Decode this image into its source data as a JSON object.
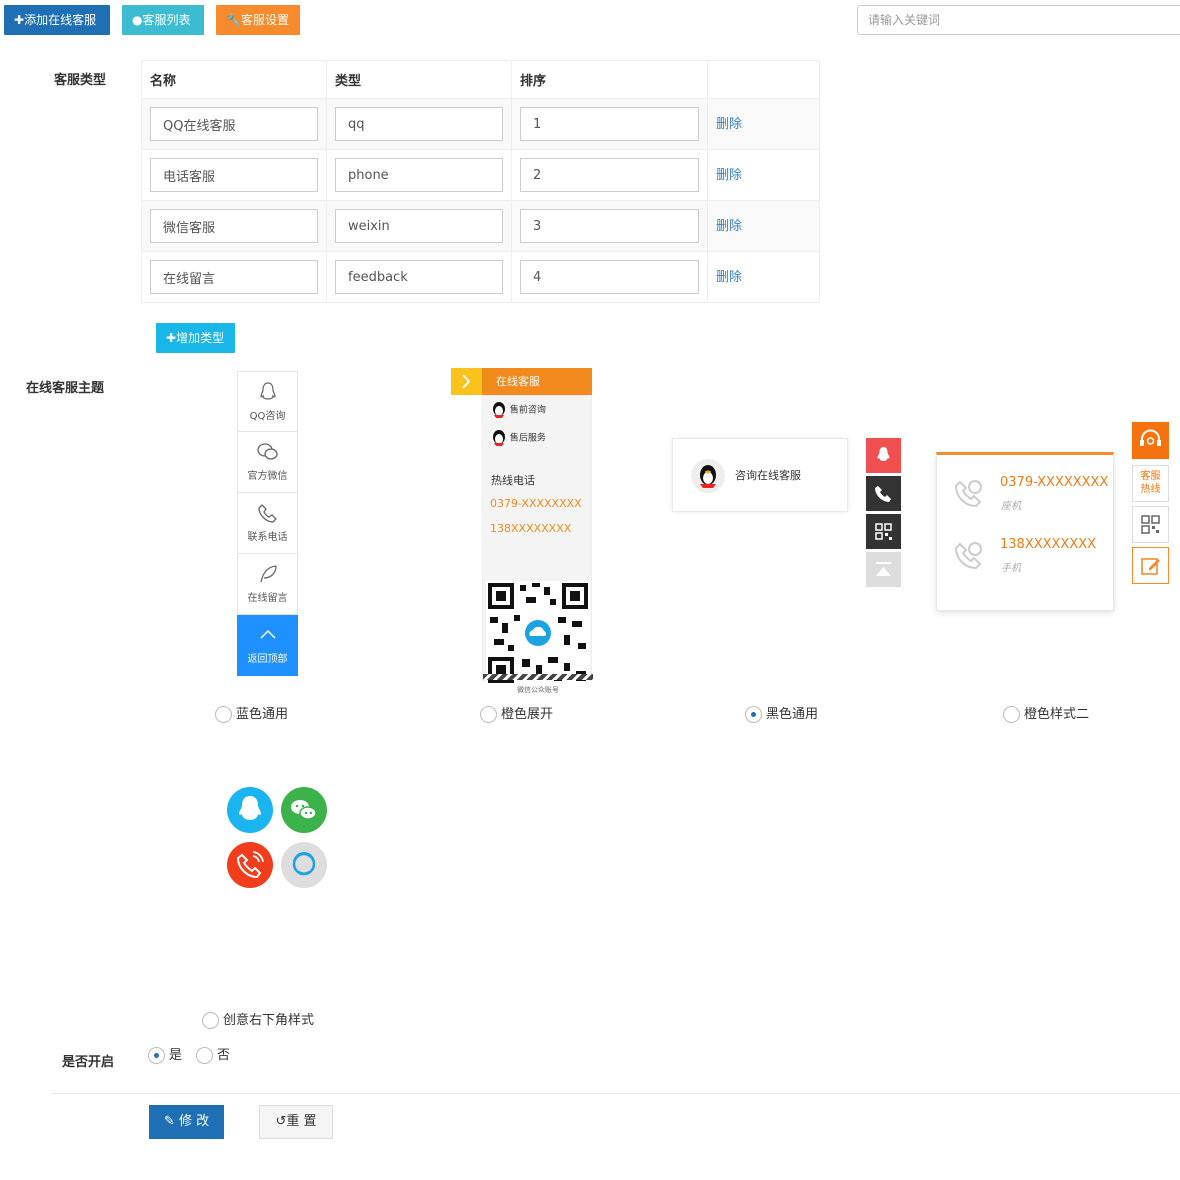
{
  "toolbar": {
    "add_label": "添加在线客服",
    "list_label": "客服列表",
    "settings_label": "客服设置",
    "search_placeholder": "请输入关键词"
  },
  "form": {
    "types_label": "客服类型",
    "theme_label": "在线客服主题",
    "enable_label": "是否开启"
  },
  "table": {
    "headers": [
      "名称",
      "类型",
      "排序",
      ""
    ],
    "rows": [
      {
        "name": "QQ在线客服",
        "type": "qq",
        "order": "1",
        "action": "删除"
      },
      {
        "name": "电话客服",
        "type": "phone",
        "order": "2",
        "action": "删除"
      },
      {
        "name": "微信客服",
        "type": "weixin",
        "order": "3",
        "action": "删除"
      },
      {
        "name": "在线留言",
        "type": "feedback",
        "order": "4",
        "action": "删除"
      }
    ],
    "add_type_label": "增加类型"
  },
  "themes": {
    "blue": {
      "items": [
        "QQ咨询",
        "官方微信",
        "联系电话",
        "在线留言",
        "返回顶部"
      ],
      "icons": [
        "qq-icon",
        "wechat-icon",
        "phone-icon",
        "feather-icon",
        "chevron-up-icon"
      ],
      "active_color": "#1e90ff"
    },
    "orange": {
      "header": "在线客服",
      "items": [
        "售前咨询",
        "售后服务"
      ],
      "hotline_title": "热线电话",
      "phone1": "0379-XXXXXXXX",
      "phone2": "138XXXXXXXX",
      "qr_label": "微信公众账号",
      "accent": "#f28a1d"
    },
    "black": {
      "card_text": "咨询在线客服",
      "buttons": [
        "qq-icon",
        "phone-icon",
        "qrcode-icon",
        "top-icon"
      ],
      "colors": [
        "#f05050",
        "#333333",
        "#333333",
        "#dddddd"
      ]
    },
    "orange2": {
      "phone1": "0379-XXXXXXXX",
      "phone1_sub": "座机",
      "phone2": "138XXXXXXXX",
      "phone2_sub": "手机",
      "side_label": "客服热线",
      "accent": "#f58b2c"
    },
    "options": [
      {
        "label": "蓝色通用",
        "checked": false
      },
      {
        "label": "橙色展开",
        "checked": false
      },
      {
        "label": "黑色通用",
        "checked": true
      },
      {
        "label": "橙色样式二",
        "checked": false
      },
      {
        "label": "创意右下角样式",
        "checked": false
      }
    ],
    "creative_colors": [
      "#1ab4f0",
      "#3bb24a",
      "#f23d1d",
      "#dddddd"
    ]
  },
  "enable": {
    "yes": "是",
    "no": "否",
    "value": "是"
  },
  "actions": {
    "submit": "修 改",
    "reset": "重 置"
  }
}
